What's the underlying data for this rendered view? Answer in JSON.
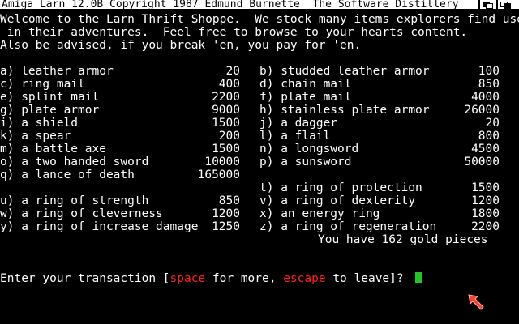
{
  "window": {
    "title": "Amiga Larn 12.0B Copyright 1987 Edmund Burnette  The Software Distillery"
  },
  "intro": [
    "Welcome to the Larn Thrift Shoppe.  We stock many items explorers find useful",
    " in their adventures.  Feel free to browse to your hearts content.",
    "Also be advised, if you break 'en, you pay for 'en."
  ],
  "items": [
    {
      "left": {
        "label": "a) leather armor",
        "price": "20"
      },
      "right": {
        "label": "b) studded leather armor",
        "price": "100"
      }
    },
    {
      "left": {
        "label": "c) ring mail",
        "price": "400"
      },
      "right": {
        "label": "d) chain mail",
        "price": "850"
      }
    },
    {
      "left": {
        "label": "e) splint mail",
        "price": "2200"
      },
      "right": {
        "label": "f) plate mail",
        "price": "4000"
      }
    },
    {
      "left": {
        "label": "g) plate armor",
        "price": "9000"
      },
      "right": {
        "label": "h) stainless plate armor",
        "price": "26000"
      }
    },
    {
      "left": {
        "label": "i) a shield",
        "price": "1500"
      },
      "right": {
        "label": "j) a dagger",
        "price": "20"
      }
    },
    {
      "left": {
        "label": "k) a spear",
        "price": "200"
      },
      "right": {
        "label": "l) a flail",
        "price": "800"
      }
    },
    {
      "left": {
        "label": "m) a battle axe",
        "price": "1500"
      },
      "right": {
        "label": "n) a longsword",
        "price": "4500"
      }
    },
    {
      "left": {
        "label": "o) a two handed sword",
        "price": "10000"
      },
      "right": {
        "label": "p) a sunsword",
        "price": "50000"
      }
    },
    {
      "left": {
        "label": "q) a lance of death",
        "price": "165000"
      },
      "right": {
        "label": "",
        "price": ""
      }
    },
    {
      "left": {
        "label": "",
        "price": ""
      },
      "right": {
        "label": "t) a ring of protection",
        "price": "1500"
      }
    },
    {
      "left": {
        "label": "u) a ring of strength",
        "price": "850"
      },
      "right": {
        "label": "v) a ring of dexterity",
        "price": "1200"
      }
    },
    {
      "left": {
        "label": "w) a ring of cleverness",
        "price": "1200"
      },
      "right": {
        "label": "x) an energy ring",
        "price": "1800"
      }
    },
    {
      "left": {
        "label": "y) a ring of increase damage",
        "price": "1250"
      },
      "right": {
        "label": "z) a ring of regeneration",
        "price": "2200"
      }
    }
  ],
  "gold": "You have 162 gold pieces",
  "prompt": {
    "before": "Enter your transaction [",
    "space": "space",
    "middle": " for more, ",
    "escape": "escape",
    "after": " to leave]? "
  },
  "colors": {
    "background": "#000000",
    "text": "#ffffff",
    "highlight": "#ff2020",
    "cursor": "#22c522",
    "pointer": "#ff4030"
  },
  "icons": {
    "back_gadget": "depth-back-icon",
    "front_gadget": "depth-front-icon",
    "pointer": "mouse-pointer-icon"
  }
}
